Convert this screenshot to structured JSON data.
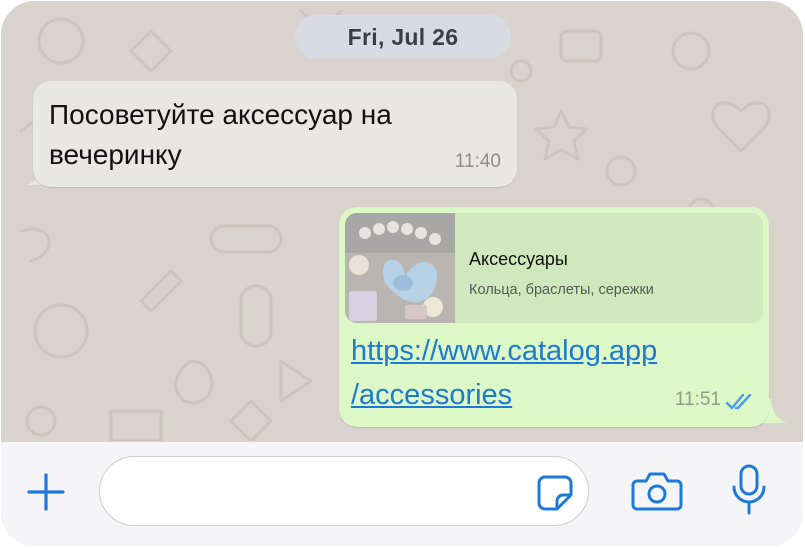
{
  "chat": {
    "date": "Fri, Jul 26",
    "incoming": {
      "text": "Посоветуйте аксессуар на вечеринку",
      "time": "11:40"
    },
    "outgoing": {
      "preview_title": "Аксессуары",
      "preview_subtitle": "Кольца, браслеты, сережки",
      "link_line1": "https://www.catalog.app",
      "link_line2": "/accessories",
      "time": "11:51",
      "status_icon": "double-check-icon"
    }
  },
  "composer": {
    "placeholder": "",
    "icons": [
      "plus-icon",
      "sticker-icon",
      "camera-icon",
      "microphone-icon"
    ]
  },
  "colors": {
    "accent": "#1d7ad9",
    "outgoing_bubble": "#dcf8c6",
    "incoming_bubble": "#e9e7e4",
    "wallpaper": "#d8d3cc"
  }
}
